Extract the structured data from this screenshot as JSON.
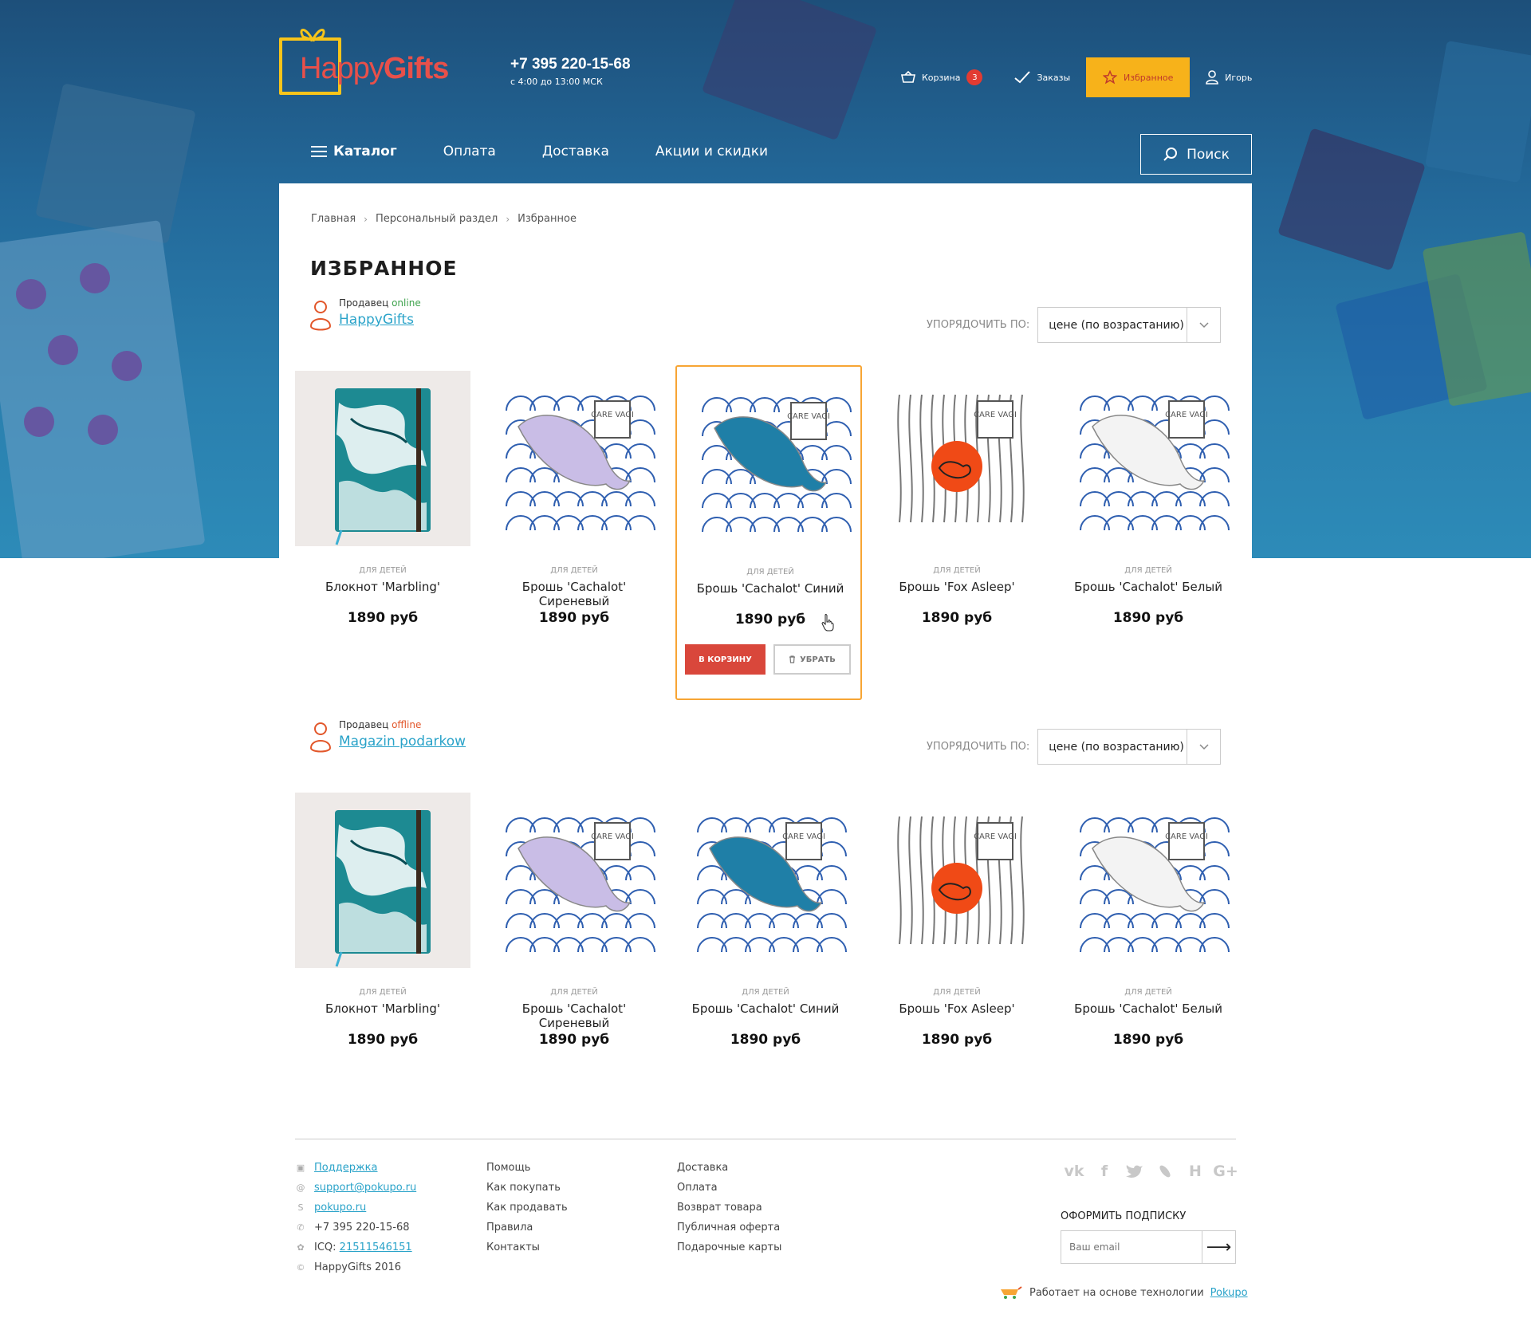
{
  "header": {
    "logo_part1": "Happy",
    "logo_part2": "Gifts",
    "phone": "+7 395 220-15-68",
    "hours": "с 4:00 до 13:00 МСК",
    "cart_label": "Корзина",
    "cart_count": "3",
    "orders_label": "Заказы",
    "favorites_label": "Избранное",
    "user_label": "Игорь"
  },
  "nav": {
    "items": [
      {
        "label": "Каталог"
      },
      {
        "label": "Оплата"
      },
      {
        "label": "Доставка"
      },
      {
        "label": "Акции и скидки"
      }
    ],
    "search_label": "Поиск"
  },
  "breadcrumb": [
    "Главная",
    "Персональный раздел",
    "Избранное"
  ],
  "page_title": "ИЗБРАННОЕ",
  "sort_label": "УПОРЯДОЧИТЬ ПО:",
  "sort_value": "цене (по возрастанию)",
  "seller_prefix": "Продавец",
  "sellers": [
    {
      "status": "online",
      "name": "HappyGifts",
      "products": [
        {
          "category": "ДЛЯ ДЕТЕЙ",
          "name": "Блокнот 'Marbling'",
          "price": "1890 руб",
          "image": "marble-notebook"
        },
        {
          "category": "ДЛЯ ДЕТЕЙ",
          "name": "Брошь 'Cachalot' Сиреневый",
          "price": "1890 руб",
          "image": "whale-lilac"
        },
        {
          "category": "ДЛЯ ДЕТЕЙ",
          "name": "Брошь 'Cachalot' Синий",
          "price": "1890 руб",
          "image": "whale-blue"
        },
        {
          "category": "ДЛЯ ДЕТЕЙ",
          "name": "Брошь 'Fox Asleep'",
          "price": "1890 руб",
          "image": "fox-asleep"
        },
        {
          "category": "ДЛЯ ДЕТЕЙ",
          "name": "Брошь 'Cachalot' Белый",
          "price": "1890 руб",
          "image": "whale-white"
        }
      ]
    },
    {
      "status": "offline",
      "name": "Magazin podarkow",
      "products": [
        {
          "category": "ДЛЯ ДЕТЕЙ",
          "name": "Блокнот 'Marbling'",
          "price": "1890 руб",
          "image": "marble-notebook"
        },
        {
          "category": "ДЛЯ ДЕТЕЙ",
          "name": "Брошь 'Cachalot' Сиреневый",
          "price": "1890 руб",
          "image": "whale-lilac"
        },
        {
          "category": "ДЛЯ ДЕТЕЙ",
          "name": "Брошь 'Cachalot' Синий",
          "price": "1890 руб",
          "image": "whale-blue"
        },
        {
          "category": "ДЛЯ ДЕТЕЙ",
          "name": "Брошь 'Fox Asleep'",
          "price": "1890 руб",
          "image": "fox-asleep"
        },
        {
          "category": "ДЛЯ ДЕТЕЙ",
          "name": "Брошь 'Cachalot' Белый",
          "price": "1890 руб",
          "image": "whale-white"
        }
      ]
    }
  ],
  "card_actions": {
    "add_to_cart": "В КОРЗИНУ",
    "remove": "УБРАТЬ"
  },
  "brooch_logo_text": "CARE VAGI",
  "footer": {
    "contacts": {
      "support": "Поддержка",
      "email": "support@pokupo.ru",
      "skype": "pokupo.ru",
      "phone": "+7 395 220-15-68",
      "icq_label": "ICQ:",
      "icq": "21511546151",
      "copyright": "HappyGifts 2016"
    },
    "col2": [
      "Помощь",
      "Как покупать",
      "Как продавать",
      "Правила",
      "Контакты"
    ],
    "col3": [
      "Доставка",
      "Оплата",
      "Возврат товара",
      "Публичная оферта",
      "Подарочные карты"
    ],
    "social": [
      "vk-icon",
      "facebook-icon",
      "twitter-icon",
      "ok-icon",
      "habr-icon",
      "google-plus-icon"
    ],
    "subscribe_title": "ОФОРМИТЬ ПОДПИСКУ",
    "email_placeholder": "Ваш email",
    "powered_text": "Работает на основе технологии",
    "powered_link": "Pokupo"
  },
  "colors": {
    "accent_orange": "#f7b21a",
    "accent_red": "#d9473b",
    "link_blue": "#2aa3c9"
  }
}
